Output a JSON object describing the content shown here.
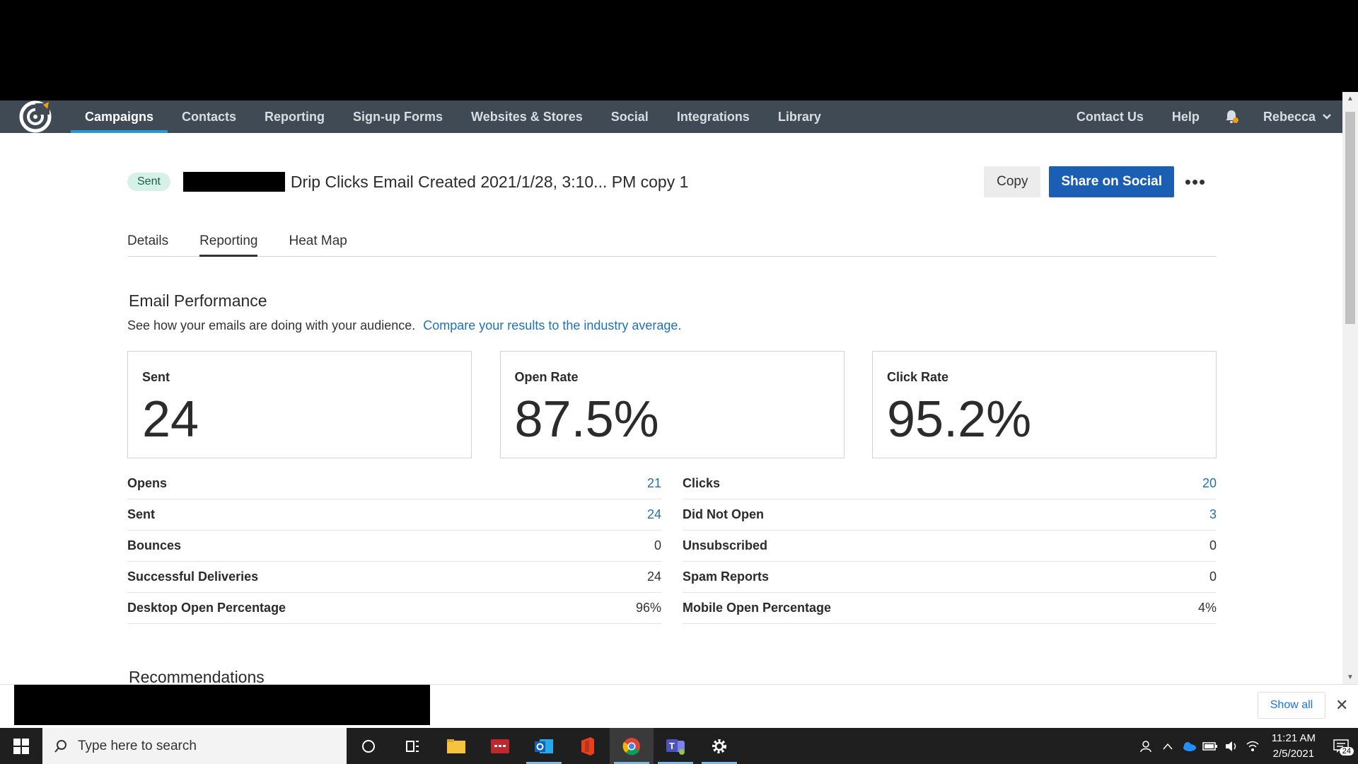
{
  "nav": {
    "items": [
      {
        "label": "Campaigns",
        "active": true
      },
      {
        "label": "Contacts"
      },
      {
        "label": "Reporting"
      },
      {
        "label": "Sign-up Forms"
      },
      {
        "label": "Websites & Stores"
      },
      {
        "label": "Social"
      },
      {
        "label": "Integrations"
      },
      {
        "label": "Library"
      }
    ],
    "contact_us": "Contact Us",
    "help": "Help",
    "user_name": "Rebecca"
  },
  "header": {
    "status_badge": "Sent",
    "title": "Drip Clicks Email Created 2021/1/28, 3:10... PM copy 1",
    "copy_button": "Copy",
    "share_button": "Share on Social",
    "more_button": "•••"
  },
  "tabs": [
    {
      "label": "Details"
    },
    {
      "label": "Reporting",
      "active": true
    },
    {
      "label": "Heat Map"
    }
  ],
  "performance": {
    "title": "Email Performance",
    "subtitle": "See how your emails are doing with your audience.",
    "compare_link": "Compare your results to the industry average."
  },
  "cards": [
    {
      "label": "Sent",
      "value": "24"
    },
    {
      "label": "Open Rate",
      "value": "87.5%"
    },
    {
      "label": "Click Rate",
      "value": "95.2%"
    }
  ],
  "stats_left": [
    {
      "label": "Opens",
      "value": "21",
      "link": true
    },
    {
      "label": "Sent",
      "value": "24",
      "link": true
    },
    {
      "label": "Bounces",
      "value": "0"
    },
    {
      "label": "Successful Deliveries",
      "value": "24"
    },
    {
      "label": "Desktop Open Percentage",
      "value": "96%"
    }
  ],
  "stats_right": [
    {
      "label": "Clicks",
      "value": "20",
      "link": true
    },
    {
      "label": "Did Not Open",
      "value": "3",
      "link": true
    },
    {
      "label": "Unsubscribed",
      "value": "0"
    },
    {
      "label": "Spam Reports",
      "value": "0"
    },
    {
      "label": "Mobile Open Percentage",
      "value": "4%"
    }
  ],
  "recommendations_title": "Recommendations",
  "download_bar": {
    "show_all": "Show all",
    "close": "✕"
  },
  "taskbar": {
    "search_placeholder": "Type here to search",
    "time": "11:21 AM",
    "date": "2/5/2021",
    "notification_count": "24"
  },
  "colors": {
    "nav_bg": "#3f4a55",
    "accent": "#2e96d3",
    "primary_button": "#1a5fb4",
    "link": "#2172b5"
  }
}
